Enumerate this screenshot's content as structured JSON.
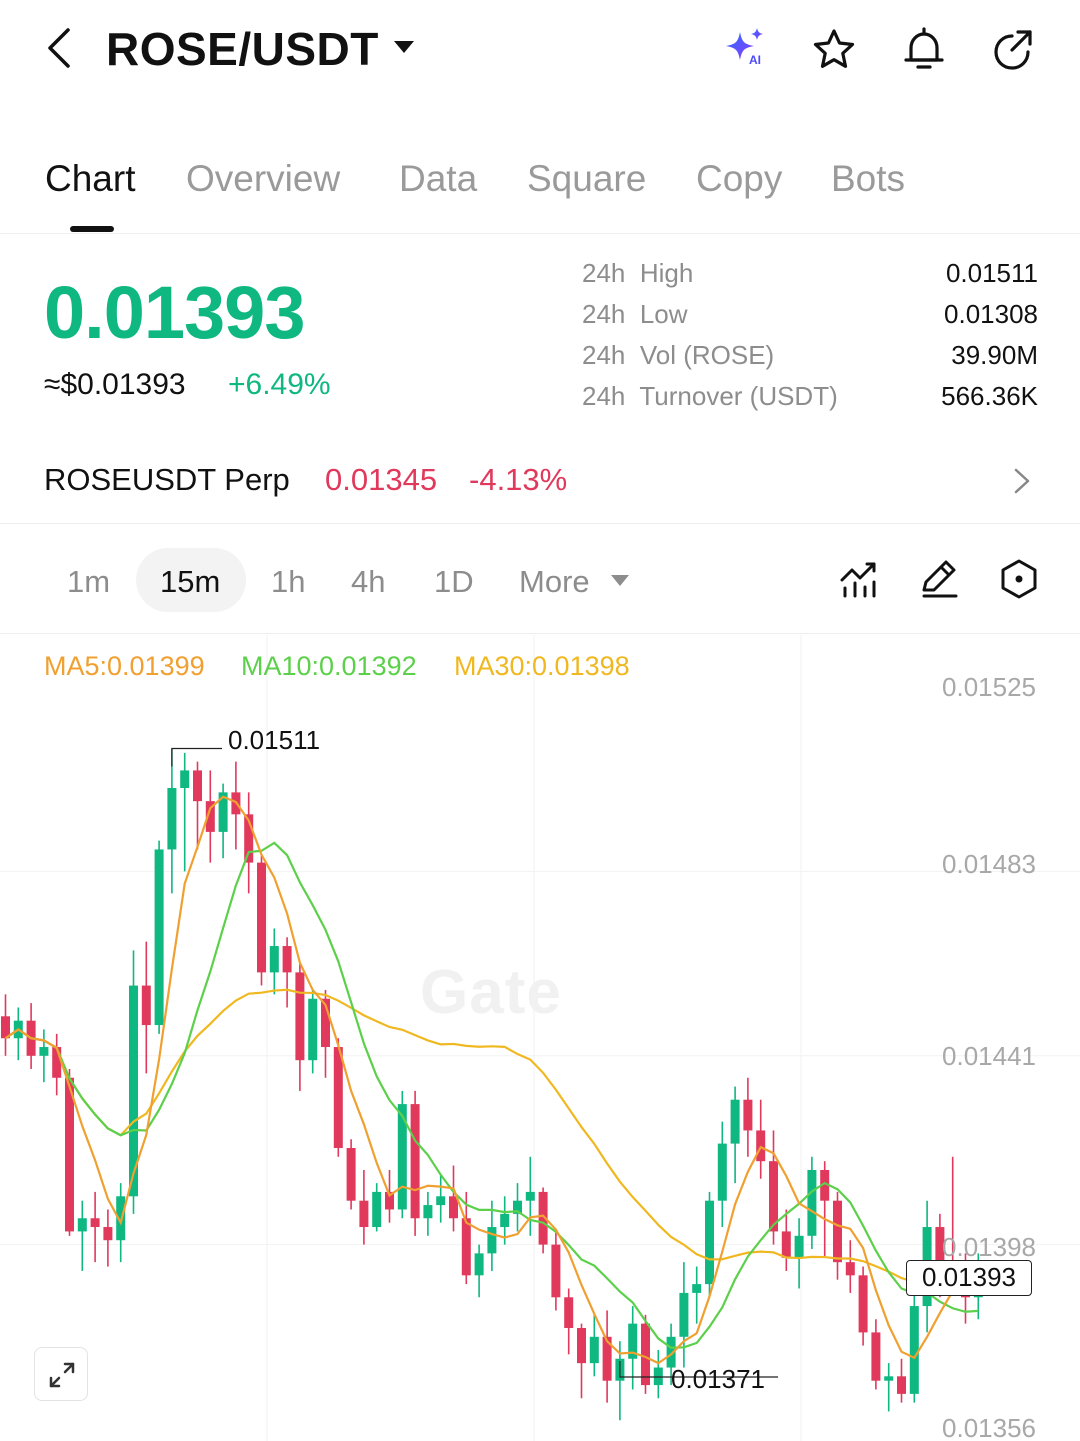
{
  "header": {
    "pair": "ROSE/USDT",
    "icons": [
      "back-icon",
      "caret-down-icon",
      "ai-sparkle-icon",
      "star-icon",
      "bell-icon",
      "share-icon"
    ],
    "ai_badge": "AI"
  },
  "tabs": [
    {
      "label": "Chart",
      "active": true
    },
    {
      "label": "Overview",
      "active": false
    },
    {
      "label": "Data",
      "active": false
    },
    {
      "label": "Square",
      "active": false
    },
    {
      "label": "Copy",
      "active": false
    },
    {
      "label": "Bots",
      "active": false
    }
  ],
  "ticker": {
    "last_price": "0.01393",
    "usd_price": "≈$0.01393",
    "change_pct": "+6.49%",
    "stats": [
      {
        "label": "24h  High",
        "value": "0.01511"
      },
      {
        "label": "24h  Low",
        "value": "0.01308"
      },
      {
        "label": "24h  Vol (ROSE)",
        "value": "39.90M"
      },
      {
        "label": "24h  Turnover (USDT)",
        "value": "566.36K"
      }
    ]
  },
  "perp": {
    "name": "ROSEUSDT Perp",
    "price": "0.01345",
    "change_pct": "-4.13%"
  },
  "intervals": {
    "items": [
      "1m",
      "15m",
      "1h",
      "4h",
      "1D"
    ],
    "active": "15m",
    "more_label": "More",
    "tool_icons": [
      "indicator-icon",
      "draw-pencil-icon",
      "settings-hexagon-icon"
    ]
  },
  "colors": {
    "up": "#0fb781",
    "down": "#e0395c",
    "ma5": "#f0a030",
    "ma10": "#5cd04a",
    "ma30": "#f0b820"
  },
  "chart": {
    "ma5_label": "MA5:0.01399",
    "ma10_label": "MA10:0.01392",
    "ma30_label": "MA30:0.01398",
    "y_ticks": [
      "0.01525",
      "0.01483",
      "0.01441",
      "0.01398",
      "0.01356"
    ],
    "current_price_tag": "0.01393",
    "high_marker": "0.01511",
    "low_marker": "0.01371",
    "watermark": "Gate"
  },
  "chart_data": {
    "type": "candlestick",
    "interval": "15m",
    "ylim": [
      0.01356,
      0.01525
    ],
    "candles": [
      {
        "o": 0.0145,
        "h": 0.01455,
        "l": 0.01441,
        "c": 0.01445
      },
      {
        "o": 0.01445,
        "h": 0.01452,
        "l": 0.0144,
        "c": 0.01449
      },
      {
        "o": 0.01449,
        "h": 0.01453,
        "l": 0.01438,
        "c": 0.01441
      },
      {
        "o": 0.01441,
        "h": 0.01447,
        "l": 0.01435,
        "c": 0.01443
      },
      {
        "o": 0.01443,
        "h": 0.01446,
        "l": 0.01432,
        "c": 0.01436
      },
      {
        "o": 0.01436,
        "h": 0.01438,
        "l": 0.014,
        "c": 0.01401
      },
      {
        "o": 0.01401,
        "h": 0.01408,
        "l": 0.01392,
        "c": 0.01404
      },
      {
        "o": 0.01404,
        "h": 0.0141,
        "l": 0.01394,
        "c": 0.01402
      },
      {
        "o": 0.01402,
        "h": 0.01406,
        "l": 0.01393,
        "c": 0.01399
      },
      {
        "o": 0.01399,
        "h": 0.01412,
        "l": 0.01394,
        "c": 0.01409
      },
      {
        "o": 0.01409,
        "h": 0.01465,
        "l": 0.01405,
        "c": 0.01457
      },
      {
        "o": 0.01457,
        "h": 0.01467,
        "l": 0.01437,
        "c": 0.01448
      },
      {
        "o": 0.01448,
        "h": 0.0149,
        "l": 0.01446,
        "c": 0.01488
      },
      {
        "o": 0.01488,
        "h": 0.01511,
        "l": 0.01478,
        "c": 0.01502
      },
      {
        "o": 0.01502,
        "h": 0.0151,
        "l": 0.01483,
        "c": 0.01506
      },
      {
        "o": 0.01506,
        "h": 0.01508,
        "l": 0.01488,
        "c": 0.01499
      },
      {
        "o": 0.01499,
        "h": 0.01506,
        "l": 0.01485,
        "c": 0.01492
      },
      {
        "o": 0.01492,
        "h": 0.01503,
        "l": 0.01486,
        "c": 0.01501
      },
      {
        "o": 0.01501,
        "h": 0.01508,
        "l": 0.01488,
        "c": 0.01496
      },
      {
        "o": 0.01496,
        "h": 0.01501,
        "l": 0.01478,
        "c": 0.01485
      },
      {
        "o": 0.01485,
        "h": 0.01487,
        "l": 0.01457,
        "c": 0.0146
      },
      {
        "o": 0.0146,
        "h": 0.0147,
        "l": 0.01455,
        "c": 0.01466
      },
      {
        "o": 0.01466,
        "h": 0.01468,
        "l": 0.01452,
        "c": 0.0146
      },
      {
        "o": 0.0146,
        "h": 0.01462,
        "l": 0.01433,
        "c": 0.0144
      },
      {
        "o": 0.0144,
        "h": 0.01456,
        "l": 0.01437,
        "c": 0.01454
      },
      {
        "o": 0.01454,
        "h": 0.01456,
        "l": 0.01436,
        "c": 0.01443
      },
      {
        "o": 0.01443,
        "h": 0.01445,
        "l": 0.01418,
        "c": 0.0142
      },
      {
        "o": 0.0142,
        "h": 0.01422,
        "l": 0.01406,
        "c": 0.01408
      },
      {
        "o": 0.01408,
        "h": 0.01415,
        "l": 0.01398,
        "c": 0.01402
      },
      {
        "o": 0.01402,
        "h": 0.01412,
        "l": 0.01401,
        "c": 0.0141
      },
      {
        "o": 0.0141,
        "h": 0.01415,
        "l": 0.01403,
        "c": 0.01406
      },
      {
        "o": 0.01406,
        "h": 0.01433,
        "l": 0.01404,
        "c": 0.0143
      },
      {
        "o": 0.0143,
        "h": 0.01433,
        "l": 0.014,
        "c": 0.01404
      },
      {
        "o": 0.01404,
        "h": 0.0141,
        "l": 0.014,
        "c": 0.01407
      },
      {
        "o": 0.01407,
        "h": 0.01414,
        "l": 0.01403,
        "c": 0.01409
      },
      {
        "o": 0.01409,
        "h": 0.01416,
        "l": 0.01401,
        "c": 0.01404
      },
      {
        "o": 0.01404,
        "h": 0.0141,
        "l": 0.01389,
        "c": 0.01391
      },
      {
        "o": 0.01391,
        "h": 0.01398,
        "l": 0.01386,
        "c": 0.01396
      },
      {
        "o": 0.01396,
        "h": 0.01408,
        "l": 0.01392,
        "c": 0.01402
      },
      {
        "o": 0.01402,
        "h": 0.01409,
        "l": 0.01398,
        "c": 0.01405
      },
      {
        "o": 0.01405,
        "h": 0.01412,
        "l": 0.01401,
        "c": 0.01408
      },
      {
        "o": 0.01408,
        "h": 0.01418,
        "l": 0.014,
        "c": 0.0141
      },
      {
        "o": 0.0141,
        "h": 0.01411,
        "l": 0.01396,
        "c": 0.01398
      },
      {
        "o": 0.01398,
        "h": 0.01401,
        "l": 0.01383,
        "c": 0.01386
      },
      {
        "o": 0.01386,
        "h": 0.01388,
        "l": 0.01373,
        "c": 0.01379
      },
      {
        "o": 0.01379,
        "h": 0.0138,
        "l": 0.01363,
        "c": 0.01371
      },
      {
        "o": 0.01371,
        "h": 0.01382,
        "l": 0.01368,
        "c": 0.01377
      },
      {
        "o": 0.01377,
        "h": 0.01383,
        "l": 0.01362,
        "c": 0.01367
      },
      {
        "o": 0.01367,
        "h": 0.01376,
        "l": 0.01358,
        "c": 0.01372
      },
      {
        "o": 0.01372,
        "h": 0.01384,
        "l": 0.01365,
        "c": 0.0138
      },
      {
        "o": 0.0138,
        "h": 0.01382,
        "l": 0.01364,
        "c": 0.01366
      },
      {
        "o": 0.01366,
        "h": 0.01374,
        "l": 0.01363,
        "c": 0.0137
      },
      {
        "o": 0.0137,
        "h": 0.0138,
        "l": 0.01366,
        "c": 0.01377
      },
      {
        "o": 0.01377,
        "h": 0.01394,
        "l": 0.0137,
        "c": 0.01387
      },
      {
        "o": 0.01387,
        "h": 0.01393,
        "l": 0.0138,
        "c": 0.01389
      },
      {
        "o": 0.01389,
        "h": 0.0141,
        "l": 0.01386,
        "c": 0.01408
      },
      {
        "o": 0.01408,
        "h": 0.01426,
        "l": 0.01402,
        "c": 0.01421
      },
      {
        "o": 0.01421,
        "h": 0.01434,
        "l": 0.01412,
        "c": 0.01431
      },
      {
        "o": 0.01431,
        "h": 0.01436,
        "l": 0.01418,
        "c": 0.01424
      },
      {
        "o": 0.01424,
        "h": 0.01431,
        "l": 0.01413,
        "c": 0.01417
      },
      {
        "o": 0.01417,
        "h": 0.01424,
        "l": 0.01398,
        "c": 0.01401
      },
      {
        "o": 0.01401,
        "h": 0.01406,
        "l": 0.01392,
        "c": 0.01395
      },
      {
        "o": 0.01395,
        "h": 0.01404,
        "l": 0.01388,
        "c": 0.014
      },
      {
        "o": 0.014,
        "h": 0.01418,
        "l": 0.01397,
        "c": 0.01415
      },
      {
        "o": 0.01415,
        "h": 0.01417,
        "l": 0.01395,
        "c": 0.01408
      },
      {
        "o": 0.01408,
        "h": 0.0141,
        "l": 0.0139,
        "c": 0.01394
      },
      {
        "o": 0.01394,
        "h": 0.01399,
        "l": 0.01387,
        "c": 0.01391
      },
      {
        "o": 0.01391,
        "h": 0.01393,
        "l": 0.01375,
        "c": 0.01378
      },
      {
        "o": 0.01378,
        "h": 0.01381,
        "l": 0.01365,
        "c": 0.01367
      },
      {
        "o": 0.01367,
        "h": 0.01371,
        "l": 0.0136,
        "c": 0.01368
      },
      {
        "o": 0.01368,
        "h": 0.01372,
        "l": 0.01362,
        "c": 0.01364
      },
      {
        "o": 0.01364,
        "h": 0.01388,
        "l": 0.01362,
        "c": 0.01384
      },
      {
        "o": 0.01384,
        "h": 0.01408,
        "l": 0.01378,
        "c": 0.01402
      },
      {
        "o": 0.01402,
        "h": 0.01405,
        "l": 0.01386,
        "c": 0.01394
      },
      {
        "o": 0.01394,
        "h": 0.01418,
        "l": 0.0139,
        "c": 0.01393
      },
      {
        "o": 0.01393,
        "h": 0.01396,
        "l": 0.0138,
        "c": 0.01386
      },
      {
        "o": 0.01386,
        "h": 0.01396,
        "l": 0.01381,
        "c": 0.01393
      }
    ]
  }
}
